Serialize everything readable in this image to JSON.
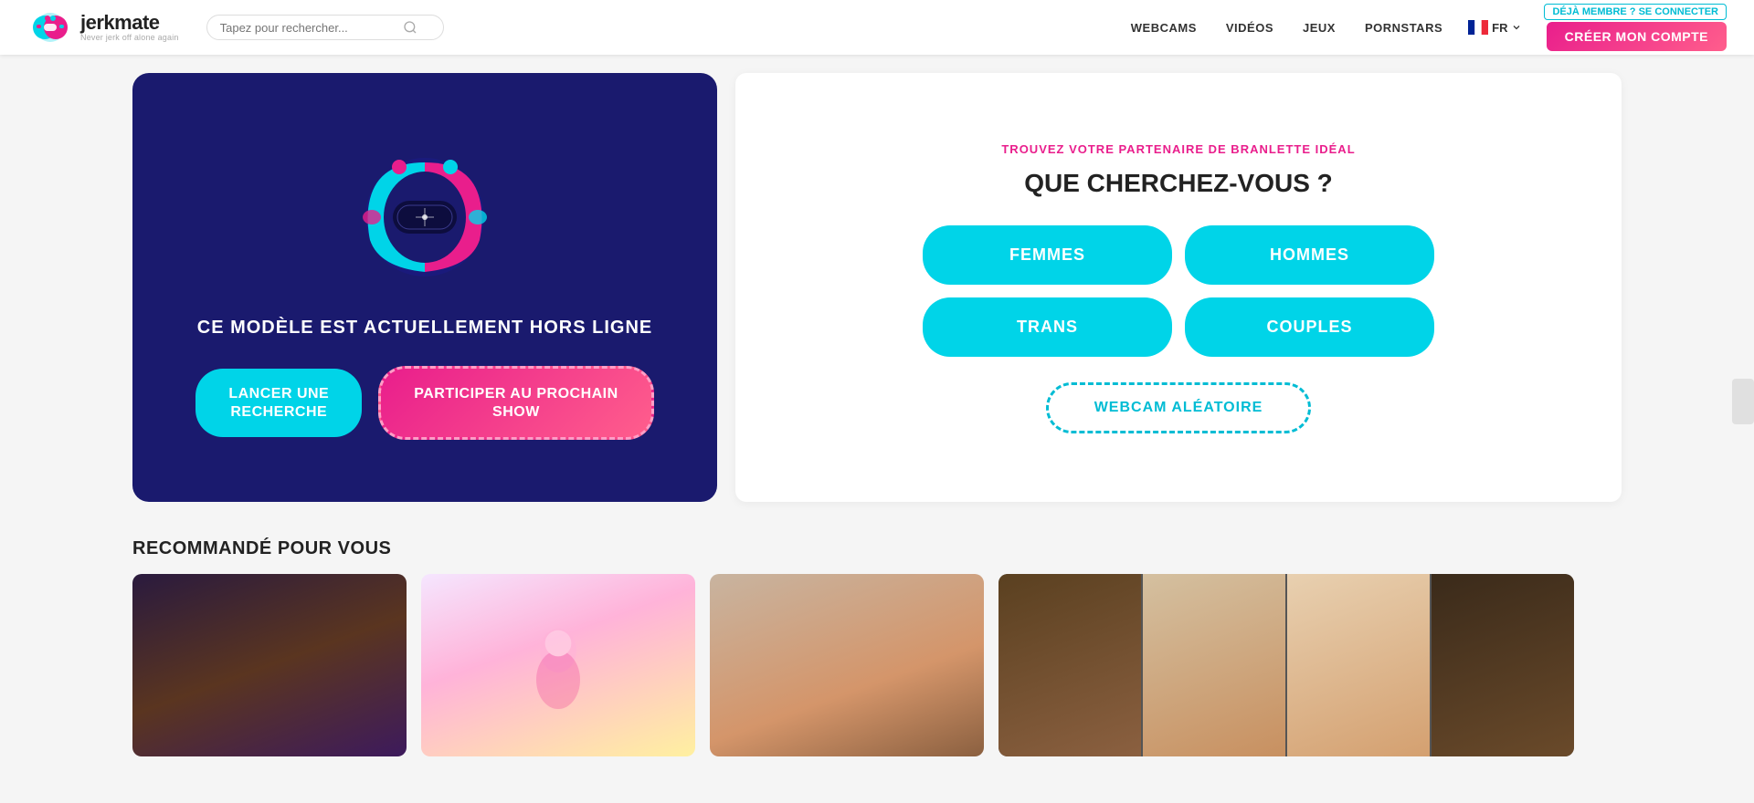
{
  "header": {
    "logo_title": "jerkmate",
    "logo_tm": "™",
    "logo_subtitle": "Never jerk off alone again",
    "search_placeholder": "Tapez pour rechercher...",
    "nav_items": [
      {
        "label": "WEBCAMS",
        "href": "#"
      },
      {
        "label": "VIDÉOS",
        "href": "#"
      },
      {
        "label": "JEUX",
        "href": "#"
      },
      {
        "label": "PORNSTARS",
        "href": "#"
      }
    ],
    "lang_label": "FR",
    "login_label": "DÉJÀ MEMBRE ? SE CONNECTER",
    "signup_label": "CRÉER MON COMPTE"
  },
  "hero": {
    "offline_message": "CE MODÈLE EST ACTUELLEMENT HORS LIGNE",
    "btn_search": "LANCER UNE\nRECHERCHE",
    "btn_show": "PARTICIPER AU PROCHAIN\nSHOW"
  },
  "selector": {
    "find_label": "TROUVEZ VOTRE PARTENAIRE DE BRANLETTE IDÉAL",
    "question": "QUE CHERCHEZ-VOUS ?",
    "categories": [
      {
        "label": "FEMMES",
        "id": "femmes"
      },
      {
        "label": "HOMMES",
        "id": "hommes"
      },
      {
        "label": "TRANS",
        "id": "trans"
      },
      {
        "label": "COUPLES",
        "id": "couples"
      }
    ],
    "random_btn": "WEBCAM ALÉATOIRE"
  },
  "recommended": {
    "title": "RECOMMANDÉ POUR VOUS",
    "cards": [
      {
        "id": "card-1",
        "type": "dark"
      },
      {
        "id": "card-2",
        "type": "light"
      },
      {
        "id": "card-3",
        "type": "multi"
      }
    ]
  }
}
